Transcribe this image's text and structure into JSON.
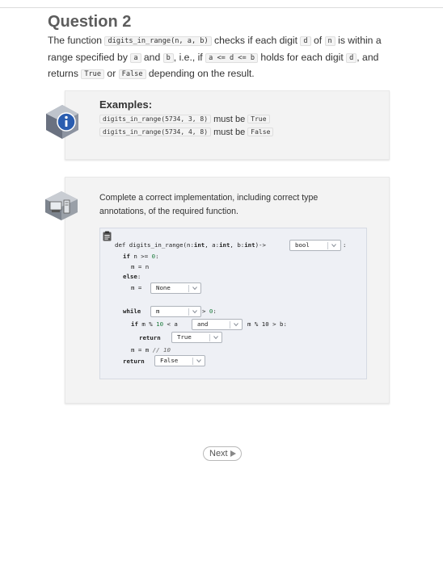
{
  "question": {
    "title": "Question 2"
  },
  "intro": {
    "t1": "The function ",
    "c1": "digits_in_range(n, a, b)",
    "t2": " checks if each digit ",
    "c2": "d",
    "t3": " of ",
    "c3": "n",
    "t4": " is within a range specified by ",
    "c4": "a",
    "t5": " and ",
    "c5": "b",
    "t6": ", i.e., if ",
    "c6": "a <= d <= b",
    "t7": " holds for each digit ",
    "c7": "d",
    "t8": ", and returns ",
    "c8": "True",
    "t9": " or ",
    "c9": "False",
    "t10": " depending on the result."
  },
  "examples": {
    "heading": "Examples:",
    "rows": [
      {
        "call": "digits_in_range(5734, 3, 8)",
        "text": " must be ",
        "result": "True"
      },
      {
        "call": "digits_in_range(5734, 4, 8)",
        "text": " must be ",
        "result": "False"
      }
    ]
  },
  "task": {
    "prompt": "Complete a correct implementation, including correct type annotations, of the required function."
  },
  "code": {
    "l1": {
      "pre": "def digits_in_range(n:",
      "t1": "int",
      "mid1": ", a:",
      "t2": "int",
      "mid2": ", b:",
      "t3": "int",
      "arrow": ")->",
      "colon": ":"
    },
    "l2": {
      "kw": "if",
      "rest": " n >= ",
      "num": "0",
      "end": ":"
    },
    "l3": {
      "text": "m = n"
    },
    "l4": {
      "kw": "else",
      "end": ":"
    },
    "l5": {
      "text": "m ="
    },
    "l6": {
      "kw": "while",
      "op": " > ",
      "num": "0",
      "end": ":"
    },
    "l7": {
      "kw": "if",
      "pre": " m % ",
      "num": "10",
      "post": " < a",
      "after": "m % 10 > b:"
    },
    "l8": {
      "kw": "return"
    },
    "l9": {
      "pre": "m = m ",
      "cmt": "// 10"
    },
    "l10": {
      "kw": "return"
    }
  },
  "dropdowns": {
    "return_type": "bool",
    "else_value": "None",
    "while_var": "m",
    "logic_op": "and",
    "inner_return": "True",
    "final_return": "False"
  },
  "nav": {
    "next_label": "Next"
  },
  "icons": {
    "info": "info-icon",
    "computer": "computer-icon",
    "clipboard": "clipboard-icon",
    "chevron": "chevron-down-icon",
    "play": "play-icon"
  }
}
